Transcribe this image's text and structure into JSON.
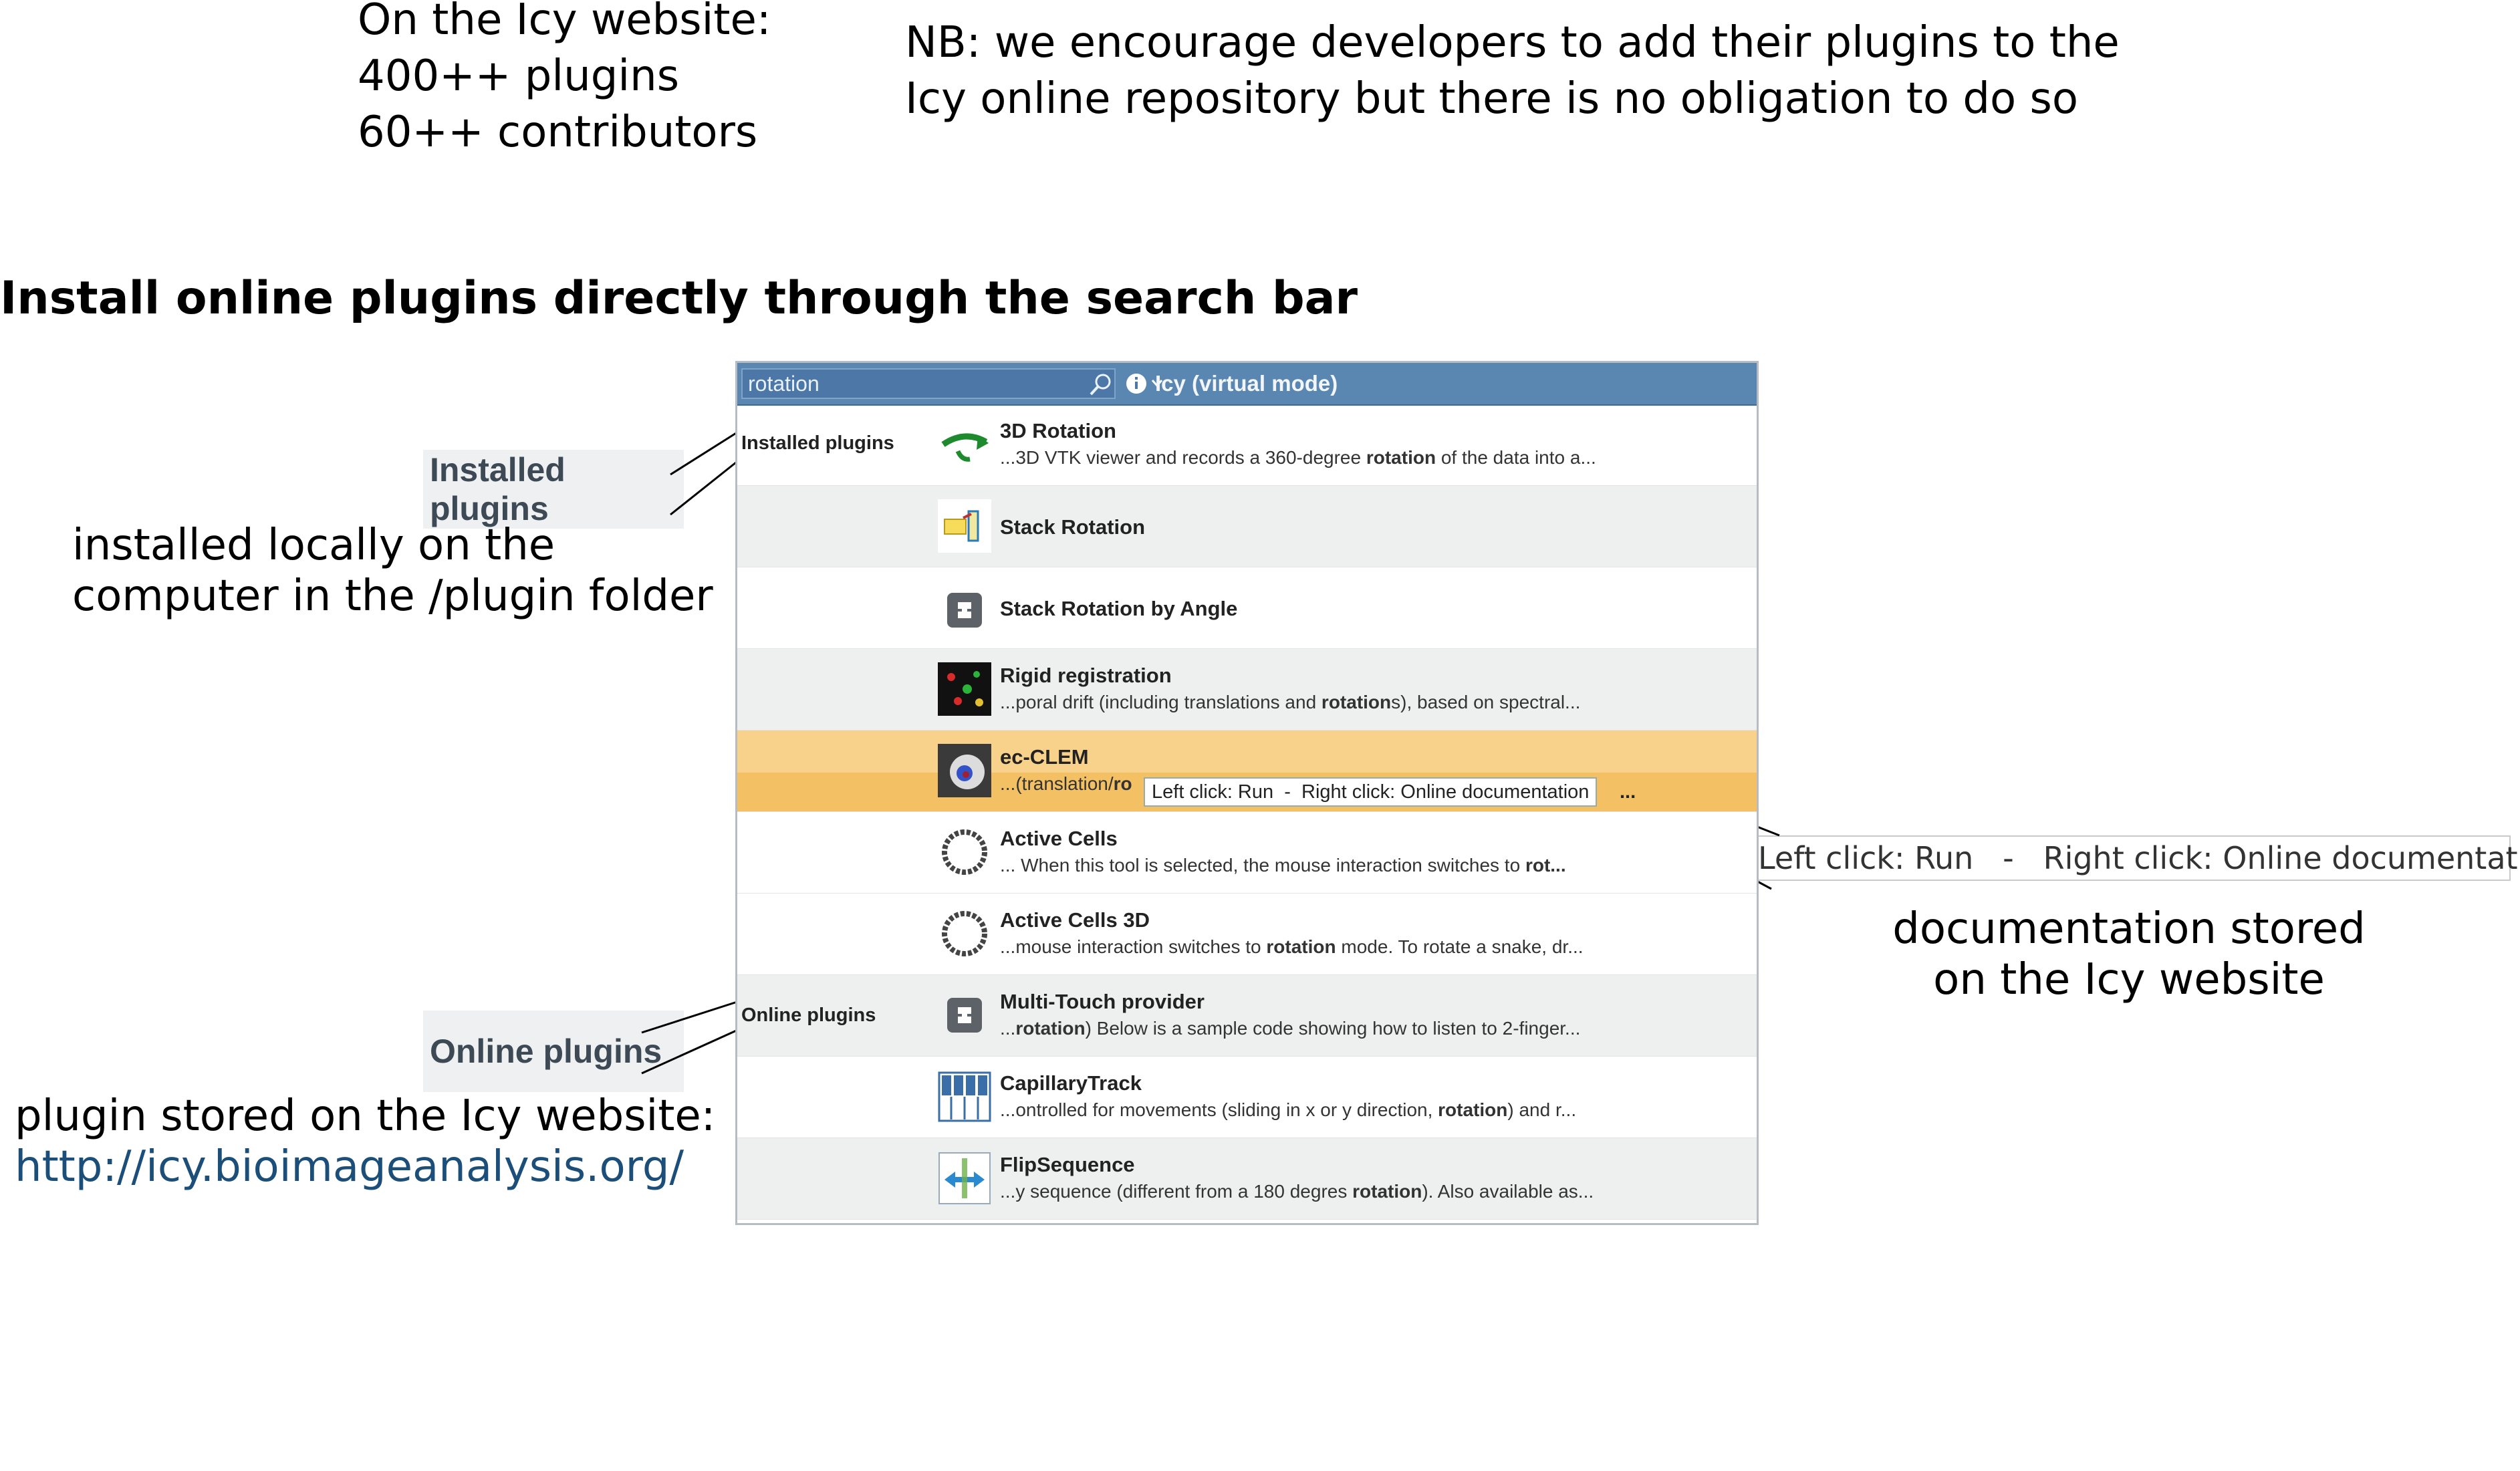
{
  "website_info": {
    "line1": "On the Icy website:",
    "line2": "400++ plugins",
    "line3": "60++ contributors"
  },
  "note": {
    "line1": "NB: we encourage developers to add their plugins to the",
    "line2": "Icy online repository but there is no obligation to do so"
  },
  "heading": "Install online plugins directly through the search bar",
  "callouts": {
    "installed_label": "Installed plugins",
    "installed_desc_line1": "installed locally on the",
    "installed_desc_line2": "computer in the /plugin folder",
    "online_label": "Online plugins",
    "online_desc_line1": "plugin stored on the Icy website:",
    "online_link": "http://icy.bioimageanalysis.org/",
    "tooltip_text": "Left click: Run   -   Right click: Online documentation",
    "doc_desc_line1": "documentation stored",
    "doc_desc_line2": "on the Icy website"
  },
  "window": {
    "search_value": "rotation",
    "title": "Icy (virtual mode)",
    "icons": [
      "search-icon",
      "info-icon",
      "chevron-down-icon"
    ]
  },
  "sections": {
    "installed": "Installed plugins",
    "online": "Online plugins"
  },
  "plugins": [
    {
      "name": "3D Rotation",
      "desc_pre": "...3D VTK viewer and records a 360-degree ",
      "desc_bold": "rotation",
      "desc_post": " of the data into a...",
      "icon": "rotate-arrow-icon"
    },
    {
      "name": "Stack Rotation",
      "desc_pre": "",
      "desc_bold": "",
      "desc_post": "",
      "icon": "stack-rotation-icon"
    },
    {
      "name": "Stack Rotation by Angle",
      "desc_pre": "",
      "desc_bold": "",
      "desc_post": "",
      "icon": "puzzle-piece-icon"
    },
    {
      "name": "Rigid registration",
      "desc_pre": "...poral drift (including translations and ",
      "desc_bold": "rotation",
      "desc_post": "s), based on spectral...",
      "icon": "registration-icon"
    },
    {
      "name": "ec-CLEM",
      "desc_pre": "...(translation/",
      "desc_bold": "ro",
      "desc_post": "",
      "icon": "ec-clem-icon"
    },
    {
      "name": "Active Cells",
      "desc_pre": "...  When this tool is selected, the mouse interaction switches to ",
      "desc_bold": "rot...",
      "desc_post": "",
      "icon": "active-cells-icon"
    },
    {
      "name": "Active Cells 3D",
      "desc_pre": "...mouse interaction switches to ",
      "desc_bold": "rotation",
      "desc_post": " mode. To rotate a snake, dr...",
      "icon": "active-cells-3d-icon"
    },
    {
      "name": "Multi-Touch provider",
      "desc_pre": "...",
      "desc_bold": "rotation",
      "desc_post": ") Below is a sample code showing how to listen to 2-finger...",
      "icon": "puzzle-piece-icon"
    },
    {
      "name": "CapillaryTrack",
      "desc_pre": "...ontrolled for movements (sliding in x or y direction, ",
      "desc_bold": "rotation",
      "desc_post": ") and r...",
      "icon": "capillary-track-icon"
    },
    {
      "name": "FlipSequence",
      "desc_pre": "...y sequence (different from a 180 degres ",
      "desc_bold": "rotation",
      "desc_post": "). Also available as...",
      "icon": "flip-arrows-icon"
    }
  ],
  "selected_tooltip": "Left click: Run  -  Right click: Online documentation",
  "selected_tooltip_ellipsis": "..."
}
